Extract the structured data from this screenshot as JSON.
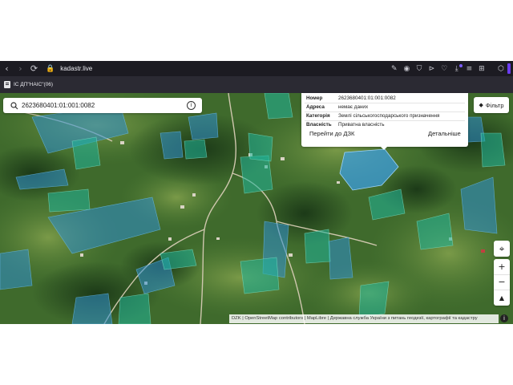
{
  "browser": {
    "url": "kadastr.live",
    "nav": {
      "back": "‹",
      "forward": "›",
      "reload": "⟳"
    },
    "lock_icon": "🔒",
    "toolbar_icons": [
      "✎",
      "◉",
      "⛉",
      "⊳",
      "♡",
      "⤓",
      "≡",
      "⊞"
    ],
    "extension_icon": "⬡",
    "accent_color": "#6b3cf0"
  },
  "bookmarks": [
    {
      "label": "ІС ДП\"НАІС\"(06)"
    }
  ],
  "search": {
    "value": "2623680401:01:001:0082",
    "info_glyph": "i"
  },
  "popup": {
    "rows": [
      {
        "key": "Номер",
        "value": "2623680401:01:001:0082"
      },
      {
        "key": "Адреса",
        "value": "немає даних"
      },
      {
        "key": "Категорія",
        "value": "Землі сільськогосподарського призначення"
      },
      {
        "key": "Власність",
        "value": "Приватна власність"
      }
    ],
    "goto_link": "Перейти до ДЗК",
    "details_link": "Детальніше"
  },
  "filter": {
    "icon": "◆",
    "label": "Фільтр"
  },
  "map_controls": {
    "locate": "⌖",
    "zoom_in": "+",
    "zoom_out": "−",
    "compass": "▲"
  },
  "attribution": {
    "text": "DZK | OpenStreetMap contributors | MapLibre | Державна служба України з питань геодезії, картографії та кадастру",
    "info_glyph": "i"
  },
  "colors": {
    "parcel_blue": "#2f8fd0",
    "parcel_teal": "#1fb59a",
    "parcel_selected": "#3aa0ea"
  }
}
